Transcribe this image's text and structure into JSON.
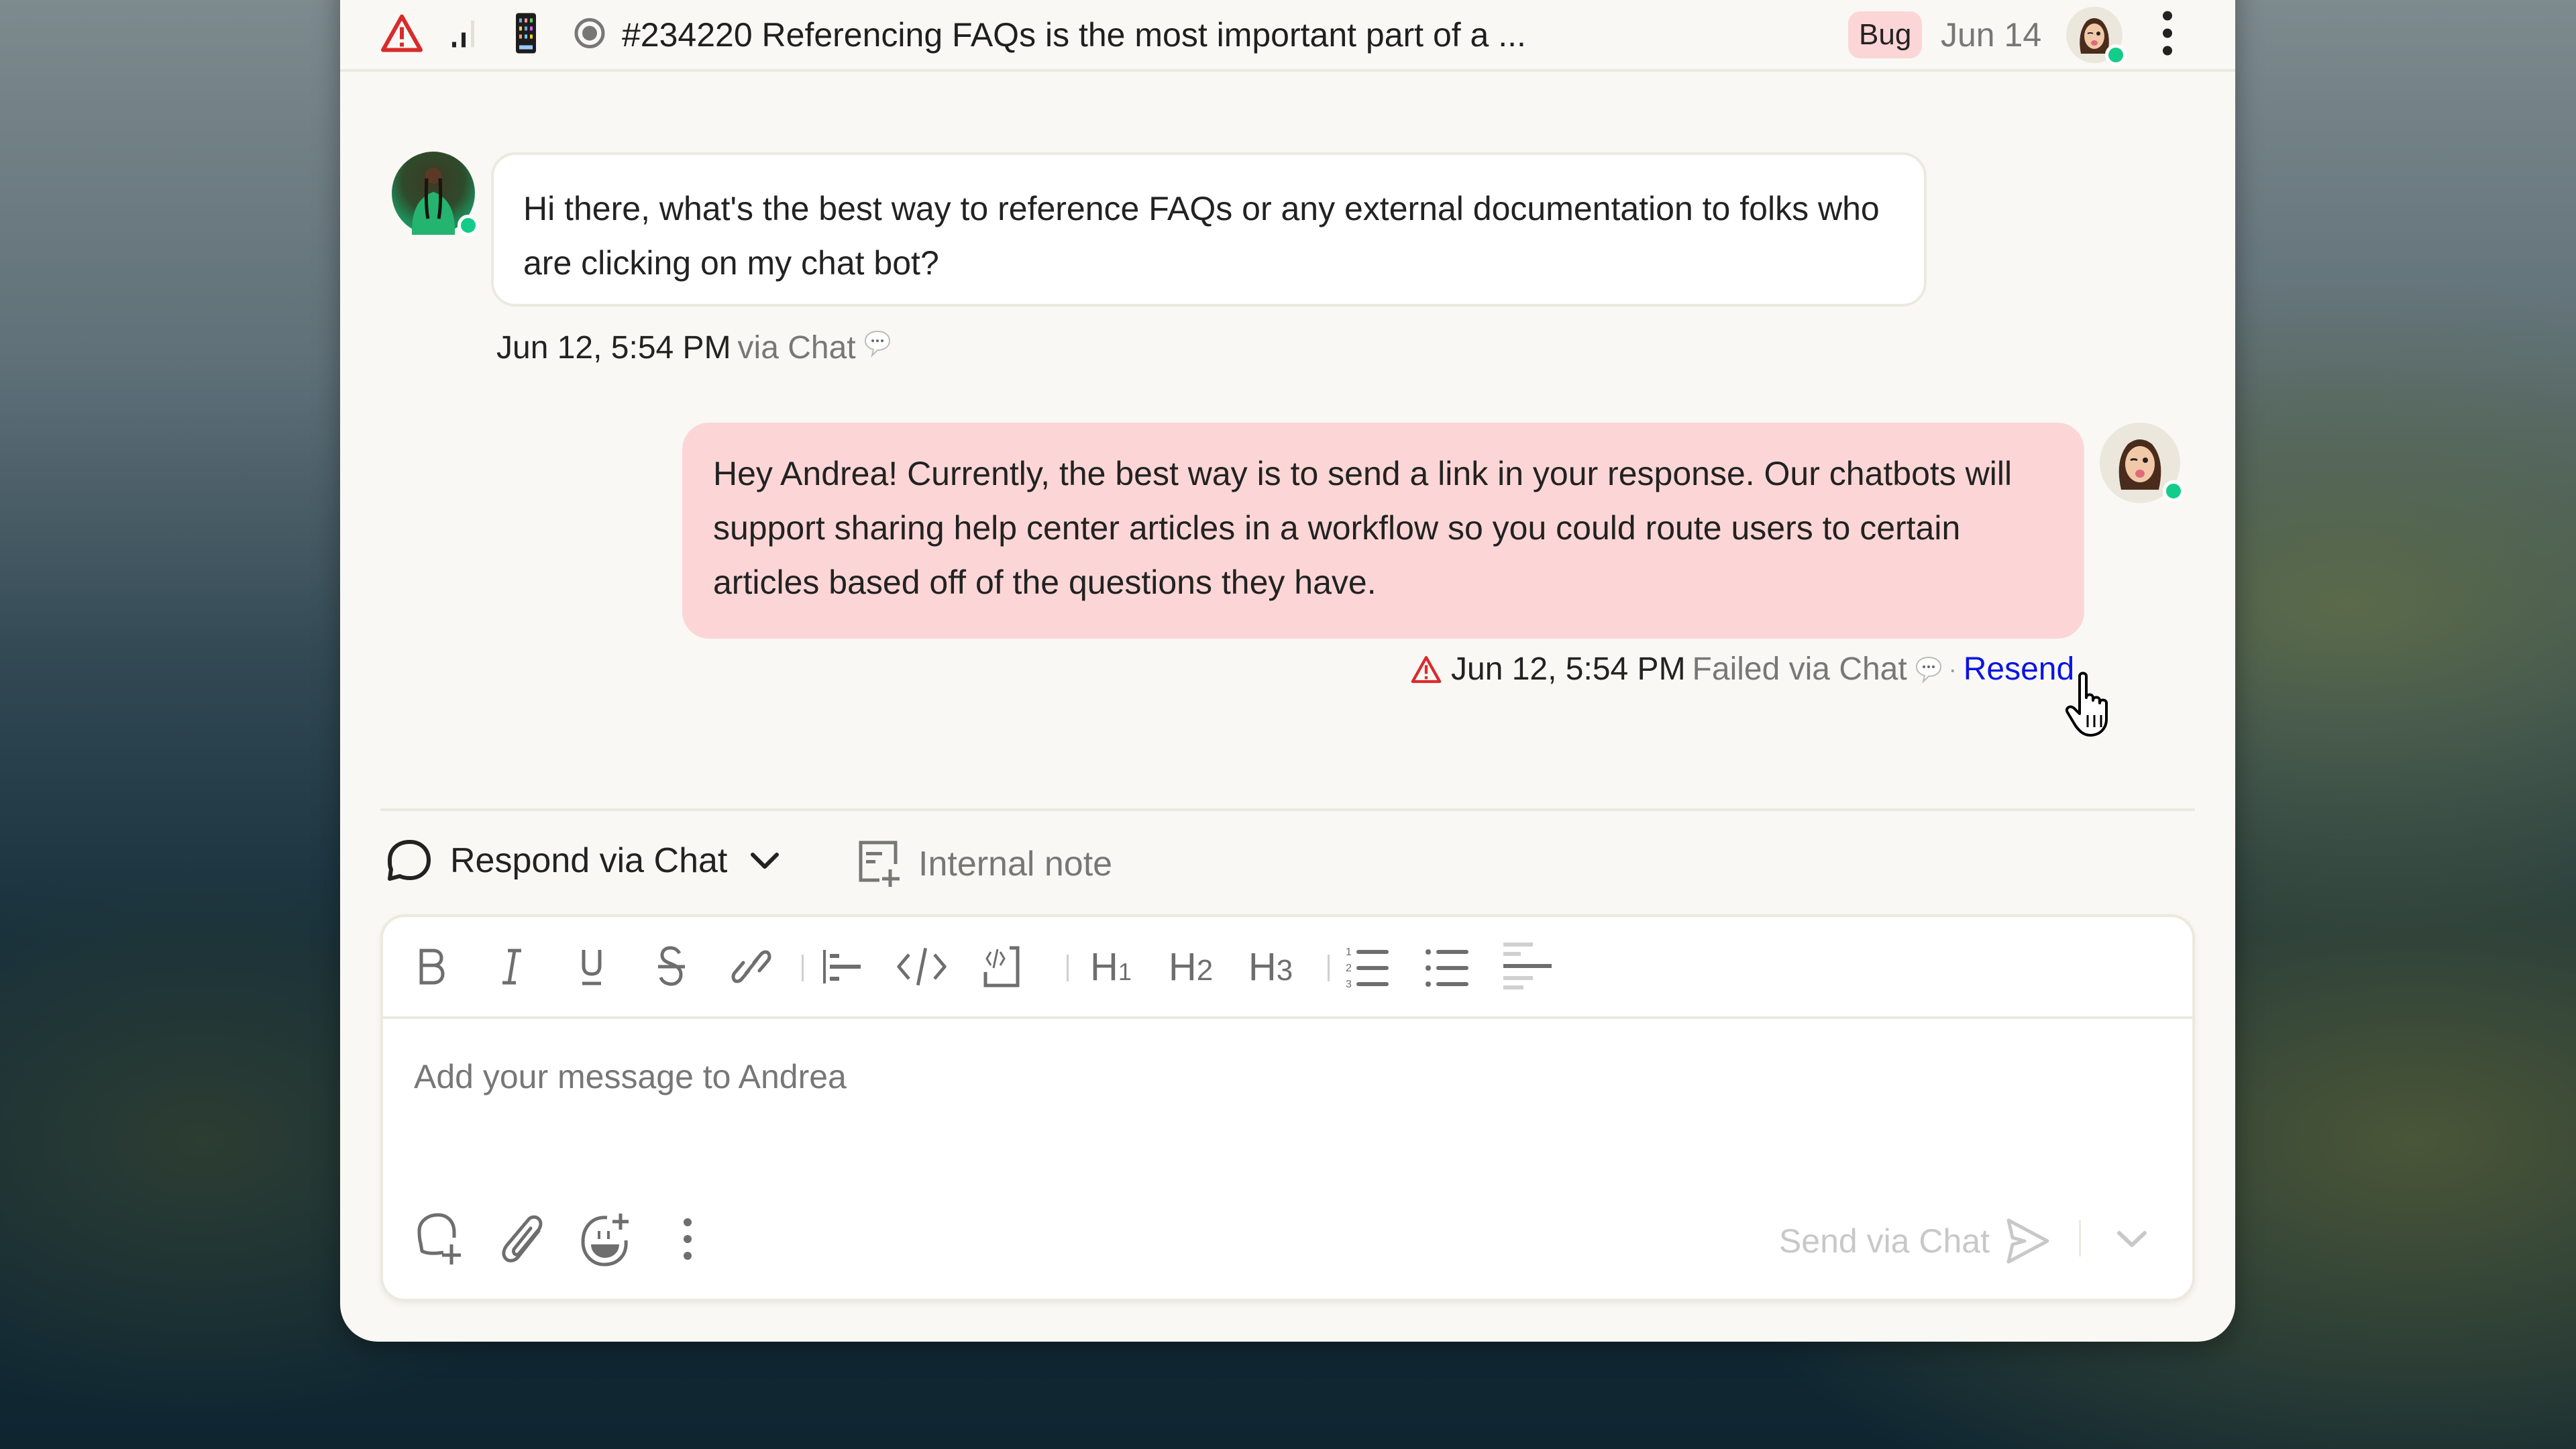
{
  "header": {
    "priority_icon": "warning-triangle-icon",
    "signal_icon": "signal-bars-icon",
    "device_icon": "phone-icon",
    "status_icon": "radio-status-icon",
    "title": "#234220 Referencing FAQs is the most important part of a ...",
    "tag": "Bug",
    "date": "Jun 14",
    "more_icon": "more-vertical-icon"
  },
  "messages": [
    {
      "direction": "incoming",
      "text": "Hi there, what's the best way to reference FAQs or any external documentation to folks who are clicking on my chat bot?",
      "timestamp": "Jun 12, 5:54 PM",
      "channel": "via Chat",
      "online": true
    },
    {
      "direction": "outgoing",
      "text": "Hey Andrea! Currently, the best way is to send a link in your response. Our chatbots will support sharing help center articles in a workflow so you could route users to certain articles based off of the questions they have.",
      "timestamp": "Jun 12, 5:54 PM",
      "channel": "Failed via Chat",
      "separator": "·",
      "action": "Resend",
      "status": "failed",
      "online": true
    }
  ],
  "composer": {
    "mode_label": "Respond via Chat",
    "note_label": "Internal note",
    "toolbar": [
      "bold",
      "italic",
      "underline",
      "strikethrough",
      "link",
      "blockquote",
      "code",
      "code-block",
      "H1",
      "H2",
      "H3",
      "ordered-list",
      "bullet-list",
      "align"
    ],
    "heading_labels": {
      "h1": "H",
      "h2": "H",
      "h3": "H",
      "h1_sub": "1",
      "h2_sub": "2",
      "h3_sub": "3"
    },
    "placeholder": "Add your message to Andrea",
    "send_label": "Send via Chat"
  },
  "colors": {
    "accent_link": "#0a14e6",
    "online": "#14cc8a",
    "warning": "#d92b2b",
    "bug_tag_bg": "#fcd6d6",
    "outgoing_bubble": "#fcd6d6"
  }
}
